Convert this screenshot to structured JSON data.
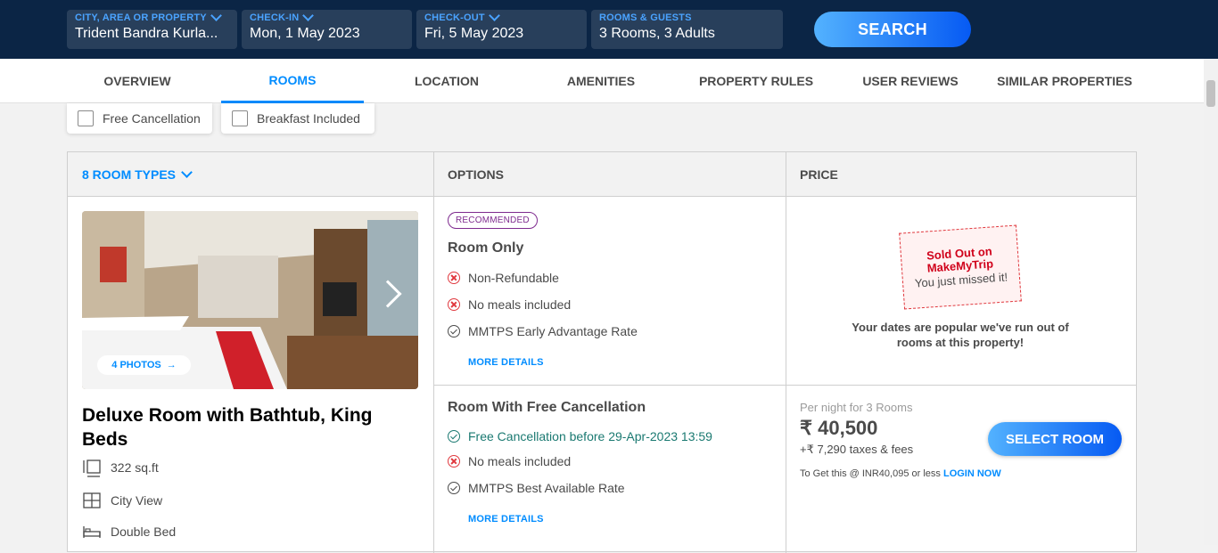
{
  "search": {
    "city": {
      "label": "CITY, AREA OR PROPERTY",
      "value": "Trident Bandra Kurla..."
    },
    "checkin": {
      "label": "CHECK-IN",
      "value": "Mon, 1 May 2023"
    },
    "checkout": {
      "label": "CHECK-OUT",
      "value": "Fri, 5 May 2023"
    },
    "rooms": {
      "label": "ROOMS & GUESTS",
      "value": "3 Rooms, 3 Adults"
    },
    "button": "SEARCH"
  },
  "tabs": [
    {
      "label": "OVERVIEW"
    },
    {
      "label": "ROOMS",
      "active": true
    },
    {
      "label": "LOCATION"
    },
    {
      "label": "AMENITIES"
    },
    {
      "label": "PROPERTY RULES"
    },
    {
      "label": "USER REVIEWS"
    },
    {
      "label": "SIMILAR PROPERTIES"
    }
  ],
  "filters": [
    {
      "label": "Free Cancellation",
      "checked": false
    },
    {
      "label": "Breakfast Included",
      "checked": false
    }
  ],
  "table": {
    "col_room_types": "8 ROOM TYPES",
    "col_options": "OPTIONS",
    "col_price": "PRICE"
  },
  "room": {
    "photos_label": "4 PHOTOS",
    "name": "Deluxe Room with Bathtub, King Beds",
    "features": [
      {
        "icon": "area-icon",
        "label": "322 sq.ft"
      },
      {
        "icon": "window-view-icon",
        "label": "City View"
      },
      {
        "icon": "bed-icon",
        "label": "Double Bed"
      }
    ]
  },
  "options": [
    {
      "badge": "RECOMMENDED",
      "title": "Room Only",
      "lines": [
        {
          "icon": "cross-circle-icon",
          "text": "Non-Refundable"
        },
        {
          "icon": "cross-circle-icon",
          "text": "No meals included"
        },
        {
          "icon": "check-circle-icon",
          "text": "MMTPS Early Advantage Rate"
        }
      ],
      "more": "MORE DETAILS",
      "price": {
        "sold_title": "Sold Out on MakeMyTrip",
        "sold_sub": "You just missed it!",
        "sold_msg": "Your dates are popular we've run out of rooms at this property!"
      }
    },
    {
      "title": "Room With Free Cancellation",
      "lines": [
        {
          "icon": "check-circle-icon",
          "text": "Free Cancellation before 29-Apr-2023 13:59",
          "color": "#1a7971"
        },
        {
          "icon": "cross-circle-icon",
          "text": "No meals included"
        },
        {
          "icon": "check-circle-icon",
          "text": "MMTPS Best Available Rate"
        }
      ],
      "more": "MORE DETAILS",
      "price": {
        "per_night": "Per night for 3 Rooms",
        "amount": "₹ 40,500",
        "taxes": "+₹ 7,290 taxes & fees",
        "login_text": "To Get this @ INR40,095 or less",
        "login_link": "LOGIN NOW",
        "button": "SELECT ROOM"
      }
    }
  ],
  "colors": {
    "navy": "#0b2545",
    "accent": "#008cff",
    "danger": "#e0383e",
    "green": "#1a7971",
    "badge": "#7e2a8e"
  }
}
